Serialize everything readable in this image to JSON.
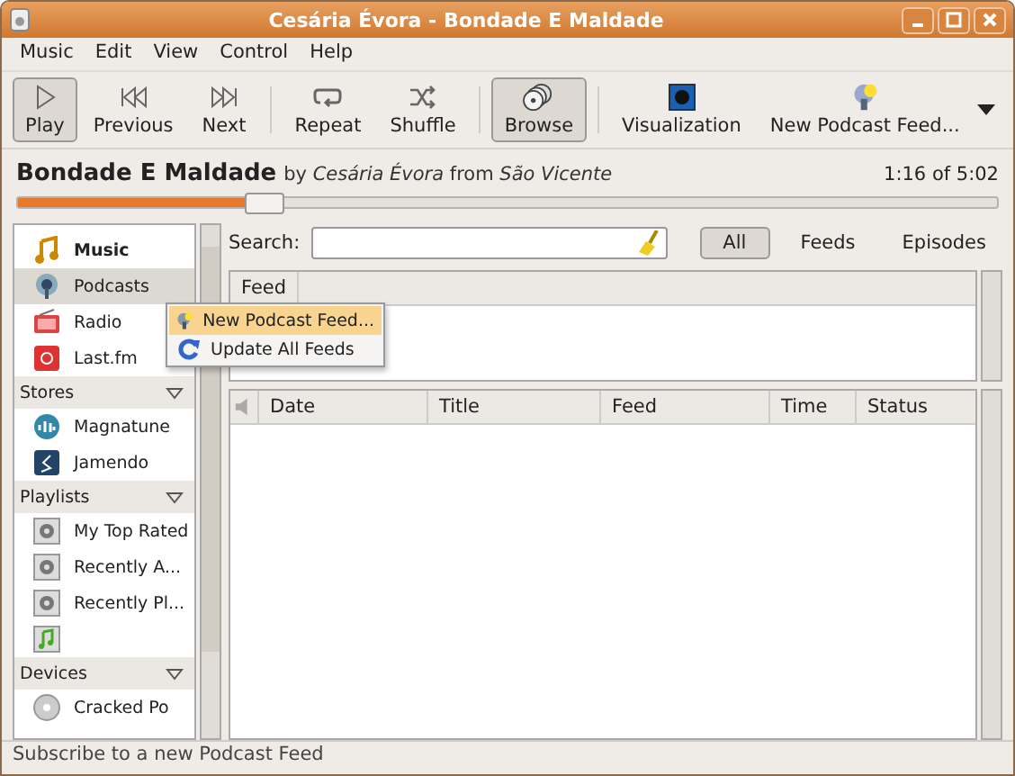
{
  "window": {
    "title": "Cesária Évora - Bondade E Maldade"
  },
  "menu": [
    "Music",
    "Edit",
    "View",
    "Control",
    "Help"
  ],
  "toolbar": [
    {
      "kind": "play",
      "label": "Play",
      "pressed": true
    },
    {
      "kind": "previous",
      "label": "Previous",
      "pressed": false
    },
    {
      "kind": "next",
      "label": "Next",
      "pressed": false
    },
    {
      "kind": "sep"
    },
    {
      "kind": "repeat",
      "label": "Repeat",
      "pressed": false
    },
    {
      "kind": "shuffle",
      "label": "Shuffle",
      "pressed": false
    },
    {
      "kind": "sep"
    },
    {
      "kind": "browse",
      "label": "Browse",
      "pressed": true
    },
    {
      "kind": "sep"
    },
    {
      "kind": "visualization",
      "label": "Visualization",
      "pressed": false
    },
    {
      "kind": "podcast",
      "label": "New Podcast Feed...",
      "pressed": false
    }
  ],
  "now_playing": {
    "title": "Bondade E Maldade",
    "details": "by *Cesária Évora* from *São Vicente*",
    "time": "1:16 of 5:02",
    "level": 0.25
  },
  "sidebar": [
    {
      "kind": "music",
      "label": "Music",
      "playing": true,
      "selected": false
    },
    {
      "kind": "podcast",
      "label": "Podcasts",
      "playing": false,
      "selected": true
    },
    {
      "kind": "radio",
      "label": "Radio",
      "playing": false,
      "selected": false
    },
    {
      "kind": "lastfm",
      "label": "Last.fm",
      "playing": false,
      "selected": false
    },
    {
      "kind": "header",
      "label": "Stores"
    },
    {
      "kind": "magnatune",
      "label": "Magnatune",
      "playing": false,
      "selected": false
    },
    {
      "kind": "jamendo",
      "label": "Jamendo",
      "playing": false,
      "selected": false
    },
    {
      "kind": "header",
      "label": "Playlists"
    },
    {
      "kind": "auto",
      "label": "My Top Rated",
      "playing": false,
      "selected": false
    },
    {
      "kind": "auto",
      "label": "Recently A...",
      "playing": false,
      "selected": false
    },
    {
      "kind": "auto",
      "label": "Recently Pl...",
      "playing": false,
      "selected": false
    },
    {
      "kind": "static",
      "selected": false
    },
    {
      "kind": "header",
      "label": "Devices"
    },
    {
      "kind": "disc",
      "label": "Cracked Po",
      "playing": false,
      "selected": false
    }
  ],
  "search": {
    "label": "Search:",
    "filters": [
      {
        "label": "All",
        "selected": true
      },
      {
        "label": "Feeds",
        "selected": false
      },
      {
        "label": "Episodes",
        "selected": false
      }
    ]
  },
  "feeds": {
    "columns": [
      "Feed"
    ]
  },
  "episodes": {
    "columns": [
      "Date",
      "Title",
      "Feed",
      "Time",
      "Status"
    ]
  },
  "context_menu": [
    {
      "kind": "new",
      "label": "New Podcast Feed...",
      "selected": true
    },
    {
      "kind": "update",
      "label": "Update All Feeds",
      "selected": false
    }
  ],
  "status_bar": "Subscribe to a new Podcast Feed"
}
